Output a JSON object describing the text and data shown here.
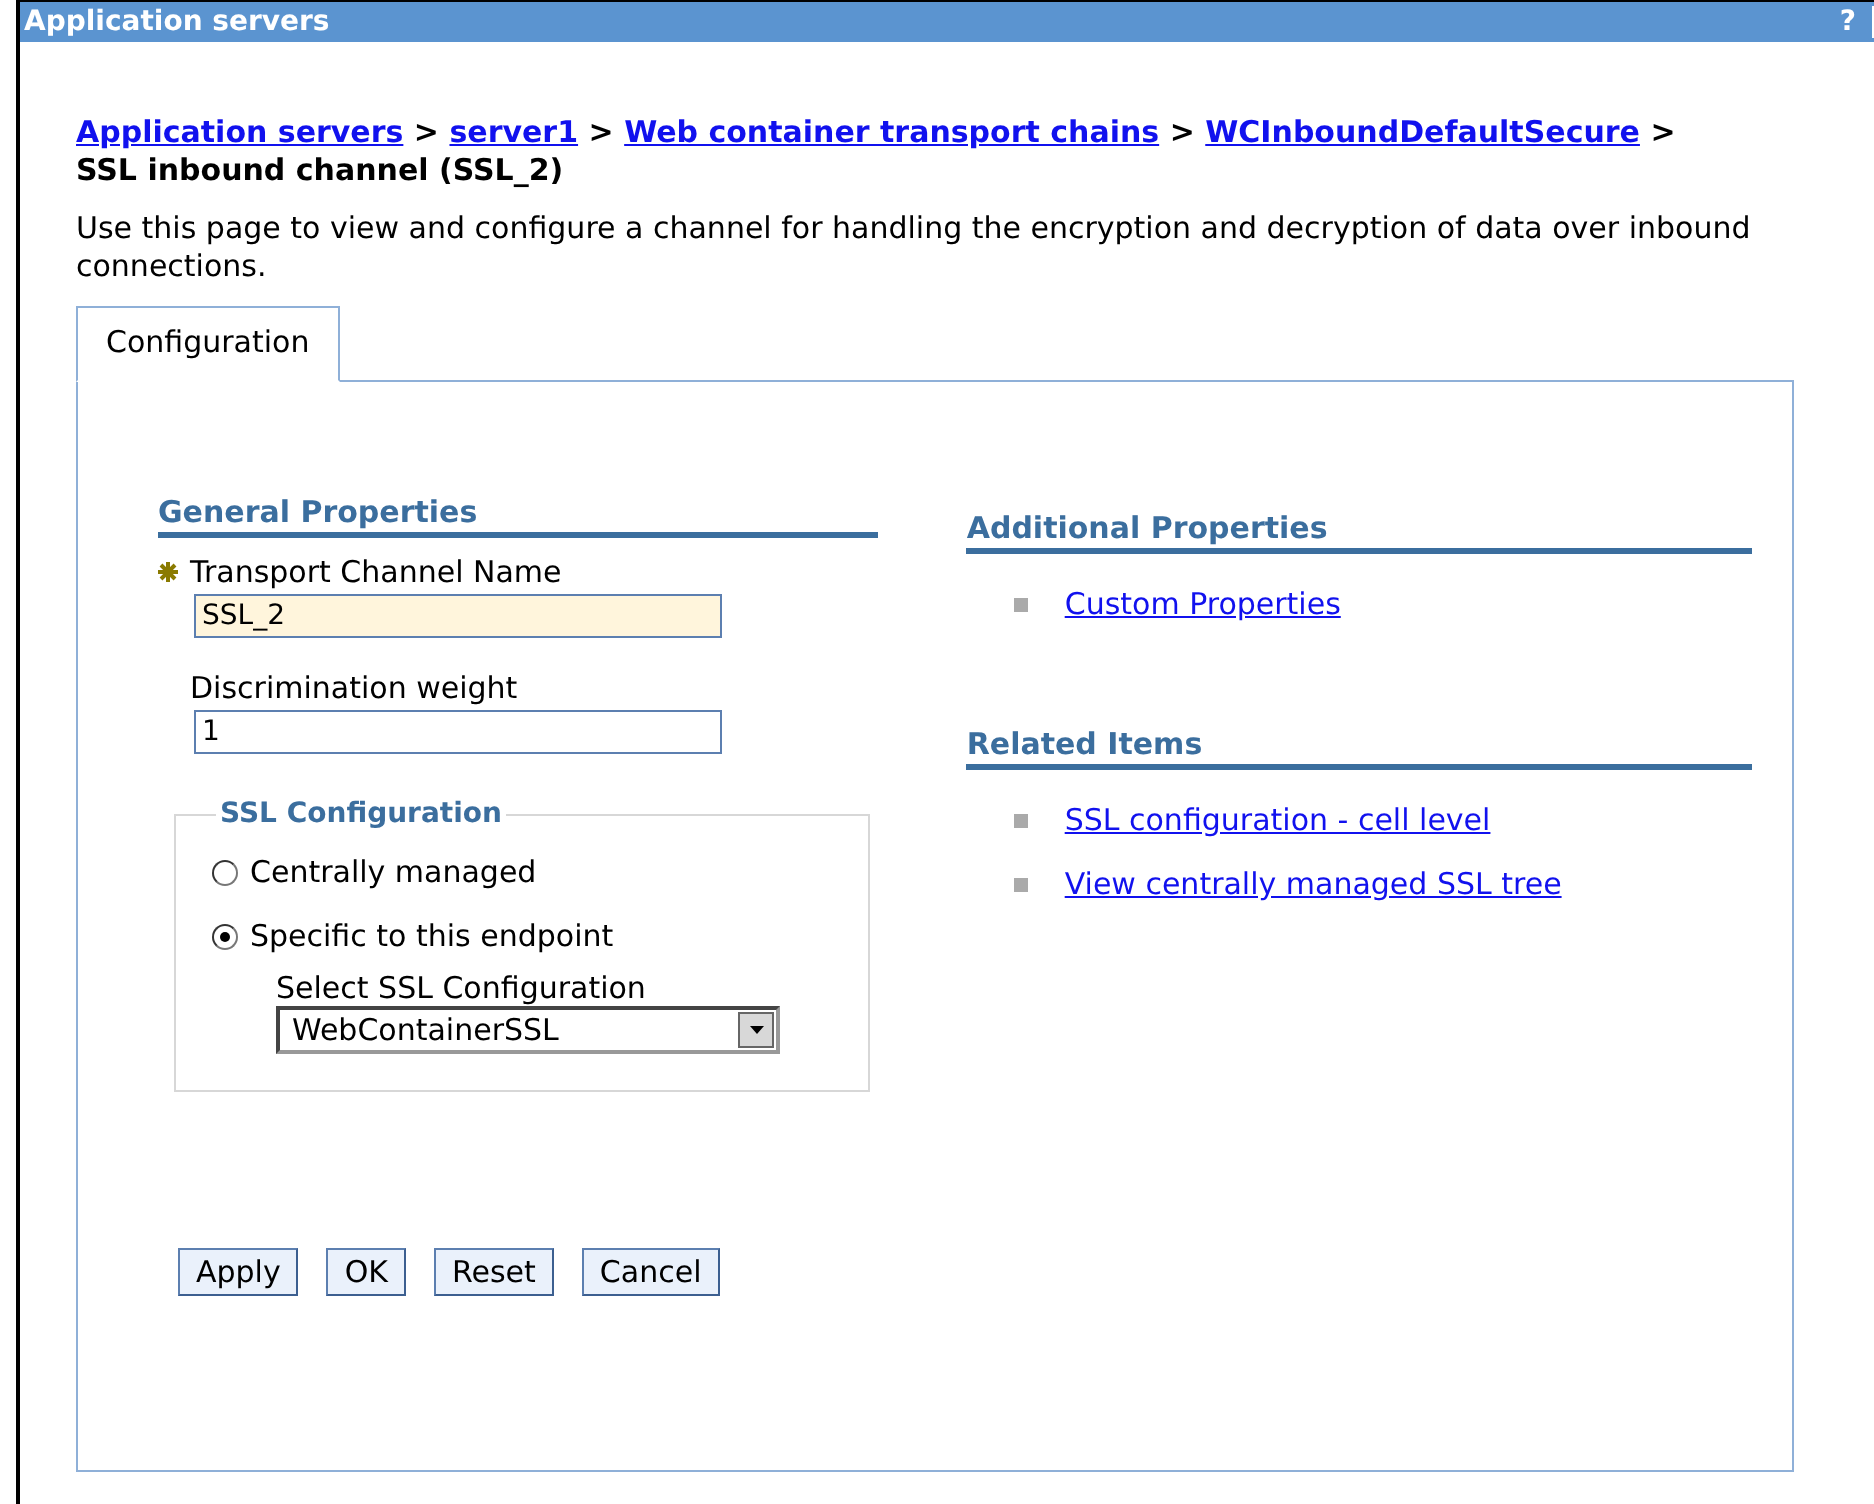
{
  "window": {
    "title": "Application servers",
    "help": "?"
  },
  "breadcrumb": [
    {
      "kind": "link",
      "label": "Application servers"
    },
    {
      "kind": "separator",
      "label": ">"
    },
    {
      "kind": "link",
      "label": "server1"
    },
    {
      "kind": "separator",
      "label": ">"
    },
    {
      "kind": "link",
      "label": "Web container transport chains"
    },
    {
      "kind": "separator",
      "label": ">"
    },
    {
      "kind": "link",
      "label": "WCInboundDefaultSecure"
    },
    {
      "kind": "separator",
      "label": ">"
    },
    {
      "kind": "current",
      "label": "SSL inbound channel (SSL_2)"
    }
  ],
  "description": "Use this page to view and configure a channel for handling the encryption and decryption of data over inbound connections.",
  "tabs": [
    {
      "label": "Configuration",
      "selected": true
    }
  ],
  "general_properties": {
    "heading": "General Properties",
    "fields": [
      {
        "label": "Transport Channel Name",
        "required": true,
        "value": "SSL_2"
      },
      {
        "label": "Discrimination weight",
        "required": false,
        "value": "1"
      }
    ],
    "ssl_configuration": {
      "legend": "SSL Configuration",
      "options": [
        {
          "label": "Centrally managed",
          "selected": false
        },
        {
          "label": "Specific to this endpoint",
          "selected": true
        }
      ],
      "select_label": "Select SSL Configuration",
      "select_value": "WebContainerSSL"
    }
  },
  "additional_properties": {
    "heading": "Additional Properties",
    "links": [
      "Custom Properties"
    ]
  },
  "related_items": {
    "heading": "Related Items",
    "links": [
      "SSL configuration - cell level",
      "View centrally managed SSL tree"
    ]
  },
  "buttons": [
    "Apply",
    "OK",
    "Reset",
    "Cancel"
  ]
}
